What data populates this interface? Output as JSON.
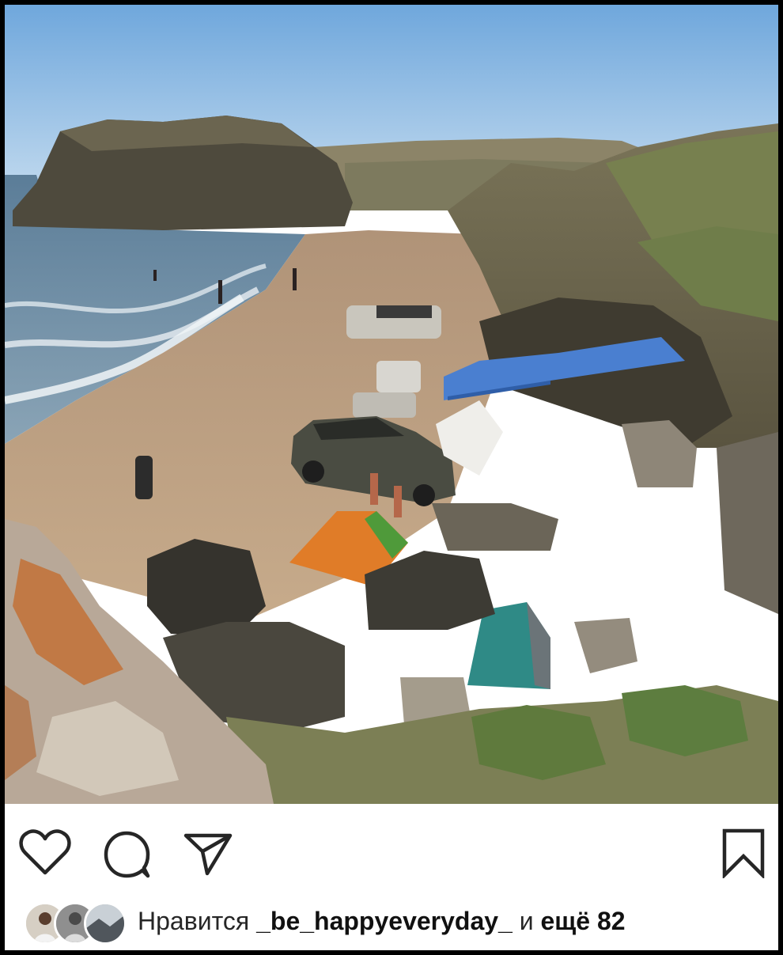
{
  "post": {
    "image_alt": "Beach with cars, tents and rocks by the sea",
    "actions": {
      "like_icon": "heart-outline-icon",
      "comment_icon": "speech-bubble-icon",
      "share_icon": "paper-plane-icon",
      "save_icon": "bookmark-icon"
    },
    "likes": {
      "prefix": "Нравится",
      "username": "_be_happyeveryday_",
      "connector": "и",
      "more": "ещё 82"
    }
  },
  "colors": {
    "sky": "#9ec6ea",
    "sea": "#6f8ea8",
    "sand": "#b89a78",
    "tarp": "#4a7fd0",
    "text": "#262626"
  }
}
